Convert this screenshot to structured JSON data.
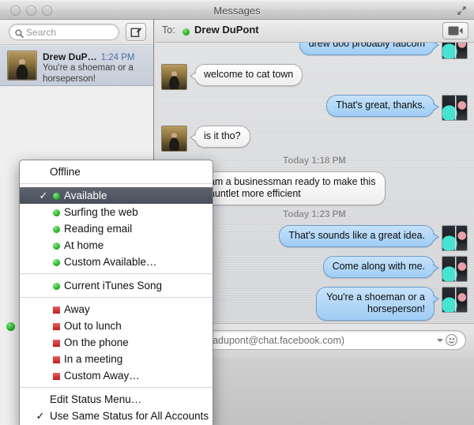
{
  "window": {
    "title": "Messages",
    "controls": [
      "close",
      "minimize",
      "zoom"
    ],
    "fullscreen_icon": "fullscreen-arrows-icon"
  },
  "sidebar": {
    "search": {
      "placeholder": "Search",
      "icon": "search-icon"
    },
    "compose": {
      "icon": "compose-icon",
      "label": "New Message"
    },
    "conversations": [
      {
        "name": "Drew DuP…",
        "time": "1:24 PM",
        "snippet": "You're a shoeman or a horseperson!",
        "avatar": "portrait-avatar",
        "selected": true
      }
    ]
  },
  "chat": {
    "to_label": "To:",
    "recipient": "Drew DuPont",
    "recipient_status": "available",
    "video_button": {
      "icon": "video-camera-icon",
      "label": "Start video chat"
    },
    "messages": [
      {
        "side": "them",
        "text": "drew doo probably faucom",
        "clipped": true,
        "avatar": "my-photo-avatar",
        "avatar_side": "right"
      },
      {
        "side": "them",
        "text": "welcome to cat town",
        "avatar": "portrait-avatar"
      },
      {
        "side": "me",
        "text": "That's great, thanks.",
        "avatar": "my-photo-avatar"
      },
      {
        "side": "them",
        "text": "is it tho?",
        "avatar": "portrait-avatar"
      },
      {
        "side": "divider",
        "text": "Today 1:18 PM"
      },
      {
        "side": "them",
        "text": "I am a businessman ready to make this gauntlet more efficient",
        "avatar": "portrait-avatar"
      },
      {
        "side": "divider",
        "text": "Today 1:23 PM"
      },
      {
        "side": "me",
        "text": "That's sounds like a great idea.",
        "avatar": "my-photo-avatar"
      },
      {
        "side": "me",
        "text": "Come along with me.",
        "avatar": "my-photo-avatar"
      },
      {
        "side": "me",
        "text": "You're a shoeman or a horseperson!",
        "avatar": "my-photo-avatar"
      }
    ],
    "input": {
      "placeholder": "from pauladupont@chat.facebook.com)",
      "smiley_icon": "smiley-face-icon",
      "disclosure_icon": "chevron-down-icon"
    }
  },
  "status_menu": {
    "items": [
      {
        "label": "Offline",
        "marker": "none",
        "checked": false,
        "selected": false
      },
      {
        "type": "separator"
      },
      {
        "label": "Available",
        "marker": "green-dot",
        "checked": true,
        "selected": true
      },
      {
        "label": "Surfing the web",
        "marker": "green-dot",
        "checked": false,
        "selected": false
      },
      {
        "label": "Reading email",
        "marker": "green-dot",
        "checked": false,
        "selected": false
      },
      {
        "label": "At home",
        "marker": "green-dot",
        "checked": false,
        "selected": false
      },
      {
        "label": "Custom Available…",
        "marker": "green-dot",
        "checked": false,
        "selected": false
      },
      {
        "type": "separator"
      },
      {
        "label": "Current iTunes Song",
        "marker": "green-dot",
        "checked": false,
        "selected": false
      },
      {
        "type": "separator"
      },
      {
        "label": "Away",
        "marker": "red-square",
        "checked": false,
        "selected": false
      },
      {
        "label": "Out to lunch",
        "marker": "red-square",
        "checked": false,
        "selected": false
      },
      {
        "label": "On the phone",
        "marker": "red-square",
        "checked": false,
        "selected": false
      },
      {
        "label": "In a meeting",
        "marker": "red-square",
        "checked": false,
        "selected": false
      },
      {
        "label": "Custom Away…",
        "marker": "red-square",
        "checked": false,
        "selected": false
      },
      {
        "type": "separator"
      },
      {
        "label": "Edit Status Menu…",
        "marker": "none",
        "checked": false,
        "selected": false
      },
      {
        "label": "Use Same Status for All Accounts",
        "marker": "none",
        "checked": true,
        "selected": false
      }
    ]
  },
  "colors": {
    "available_green": "#1bab1b",
    "away_red": "#c11c1c",
    "me_bubble": "#9fcdf4",
    "them_bubble": "#f6f6f6",
    "menu_highlight": "#4a505a",
    "timestamp_blue": "#4d6fa0"
  }
}
